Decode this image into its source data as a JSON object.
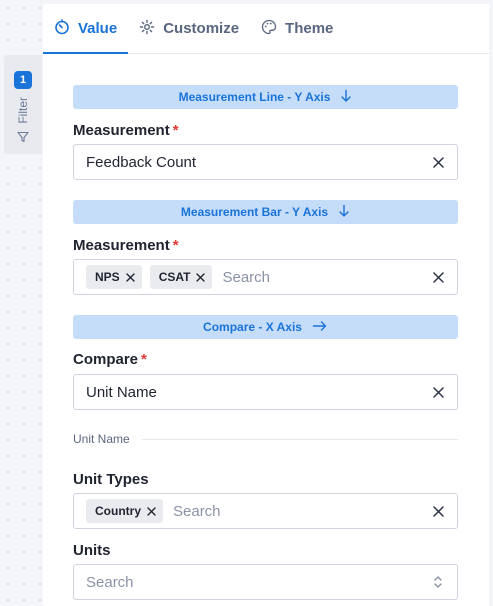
{
  "filter": {
    "badge": "1",
    "label": "Filter",
    "icon": "funnel-icon"
  },
  "tabs": [
    {
      "label": "Value",
      "icon": "timer-icon",
      "active": true
    },
    {
      "label": "Customize",
      "icon": "gear-icon",
      "active": false
    },
    {
      "label": "Theme",
      "icon": "palette-icon",
      "active": false
    }
  ],
  "sections": {
    "line_y": {
      "title": "Measurement Line - Y Axis",
      "icon": "arrow-down-icon"
    },
    "bar_y": {
      "title": "Measurement Bar - Y Axis",
      "icon": "arrow-down-icon"
    },
    "compare_x": {
      "title": "Compare - X Axis",
      "icon": "arrow-right-icon"
    }
  },
  "fields": {
    "measurement_line": {
      "label": "Measurement",
      "required": "*",
      "value": "Feedback Count"
    },
    "measurement_bar": {
      "label": "Measurement",
      "required": "*",
      "chips": [
        "NPS",
        "CSAT"
      ],
      "placeholder": "Search"
    },
    "compare": {
      "label": "Compare",
      "required": "*",
      "value": "Unit Name"
    },
    "unit_name_divider": "Unit Name",
    "unit_types": {
      "label": "Unit Types",
      "chips": [
        "Country"
      ],
      "placeholder": "Search"
    },
    "units": {
      "label": "Units",
      "placeholder": "Search"
    }
  },
  "colors": {
    "accent": "#1a73d9",
    "banner_bg": "#c5ddf8",
    "required": "#e53935"
  }
}
